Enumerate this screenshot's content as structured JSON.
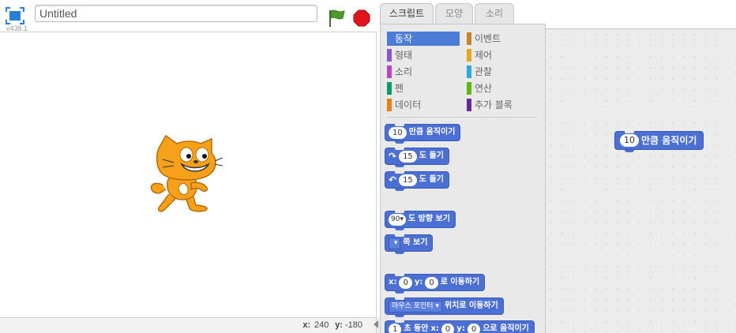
{
  "stage": {
    "version": "v438.1",
    "project_title": "Untitled",
    "mouse_x_label": "x:",
    "mouse_x": "240",
    "mouse_y_label": "y:",
    "mouse_y": "-180"
  },
  "tabs": [
    "스크립트",
    "모양",
    "소리"
  ],
  "categories": [
    {
      "label": "동작",
      "color": "#4a6cd4",
      "active": true
    },
    {
      "label": "형태",
      "color": "#8a55d7"
    },
    {
      "label": "소리",
      "color": "#bb42c3"
    },
    {
      "label": "펜",
      "color": "#0e9a6c"
    },
    {
      "label": "데이터",
      "color": "#ee7d16"
    },
    {
      "label": "이벤트",
      "color": "#c88330"
    },
    {
      "label": "제어",
      "color": "#e1a91a"
    },
    {
      "label": "관찰",
      "color": "#2ca5e2"
    },
    {
      "label": "연산",
      "color": "#5cb712"
    },
    {
      "label": "추가 블록",
      "color": "#632d99"
    }
  ],
  "blocks": {
    "move": {
      "value": "10",
      "text": "만큼 움직이기"
    },
    "turn_right": {
      "value": "15",
      "text": "도 돌기"
    },
    "turn_left": {
      "value": "15",
      "text": "도 돌기"
    },
    "point_direction": {
      "value": "90",
      "text": "도 방향 보기"
    },
    "point_towards": {
      "text": "쪽 보기"
    },
    "goto_xy": {
      "x_label": "x:",
      "x": "0",
      "y_label": "y:",
      "y": "0",
      "text": "로 이동하기"
    },
    "goto_target": {
      "target": "마우스 포인터",
      "text": "위치로 이동하기"
    },
    "glide": {
      "secs": "1",
      "t1": "초 동안",
      "x_label": "x:",
      "x": "0",
      "y_label": "y:",
      "y": "0",
      "text": "으로 움직이기"
    }
  },
  "script": {
    "value": "10",
    "text": "만큼 움직이기"
  },
  "icons": {
    "fullscreen": "fullscreen-icon",
    "green_flag": "green-flag-icon",
    "stop": "stop-icon",
    "sprite": "scratch-cat-sprite"
  }
}
